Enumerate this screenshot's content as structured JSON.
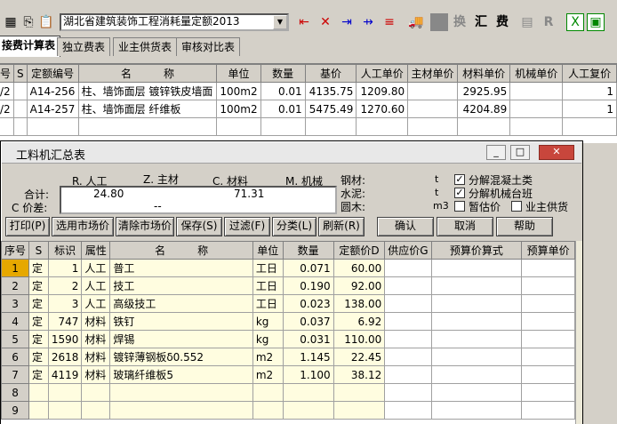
{
  "toolbar": {
    "quota_select": "湖北省建筑装饰工程消耗量定额2013",
    "glyph_huan": "换",
    "glyph_hui": "汇",
    "glyph_fei": "费",
    "glyph_r": "R"
  },
  "tabs": [
    "接费计算表",
    "独立费表",
    "业主供货表",
    "审核对比表"
  ],
  "main_grid": {
    "columns": [
      "号",
      "S",
      "定额编号",
      "名　　　称",
      "单位",
      "数量",
      "基价",
      "人工单价",
      "主材单价",
      "材料单价",
      "机械单价",
      "人工复价"
    ],
    "rows": [
      {
        "no": "/2",
        "code": "A14-256",
        "name": "柱、墙饰面层 镀锌铁皮墙面",
        "unit": "100m2",
        "qty": "0.01",
        "base": "4135.75",
        "labor": "1209.80",
        "main_mat": "",
        "mat": "2925.95",
        "mach": "",
        "labor_total": "1"
      },
      {
        "no": "/2",
        "code": "A14-257",
        "name": "柱、墙饰面层 纤维板",
        "unit": "100m2",
        "qty": "0.01",
        "base": "5475.49",
        "labor": "1270.60",
        "main_mat": "",
        "mat": "4204.89",
        "mach": "",
        "labor_total": "1"
      }
    ]
  },
  "dialog": {
    "title": "工料机汇总表",
    "summary_headers": [
      "R. 人工",
      "Z. 主材",
      "C. 材料",
      "M. 机械"
    ],
    "total_label": "合计:",
    "diff_label": "C 价差:",
    "total_labor": "24.80",
    "total_material": "71.31",
    "diff_value": "--",
    "materials": [
      {
        "label": "钢材:",
        "unit": "t"
      },
      {
        "label": "水泥:",
        "unit": "t"
      },
      {
        "label": "圆木:",
        "unit": "m3"
      }
    ],
    "options": [
      {
        "label": "分解混凝土类",
        "checked": true
      },
      {
        "label": "分解机械台班",
        "checked": true
      },
      {
        "label": "暂估价",
        "checked": false
      },
      {
        "label": "业主供货",
        "checked": false
      }
    ],
    "buttons": [
      "打印(P)",
      "选用市场价",
      "清除市场价",
      "保存(S)",
      "过滤(F)",
      "分类(L)",
      "刷新(R)",
      "确认",
      "取消",
      "帮助"
    ],
    "grid_columns": [
      "序号",
      "S",
      "标识",
      "属性",
      "名　　　称",
      "单位",
      "数量",
      "定额价D",
      "供应价G",
      "预算价算式",
      "预算单价"
    ],
    "grid_rows": [
      {
        "no": "1",
        "s": "定",
        "id": "1",
        "attr": "人工",
        "name": "普工",
        "unit": "工日",
        "qty": "0.071",
        "price": "60.00"
      },
      {
        "no": "2",
        "s": "定",
        "id": "2",
        "attr": "人工",
        "name": "技工",
        "unit": "工日",
        "qty": "0.190",
        "price": "92.00"
      },
      {
        "no": "3",
        "s": "定",
        "id": "3",
        "attr": "人工",
        "name": "高级技工",
        "unit": "工日",
        "qty": "0.023",
        "price": "138.00"
      },
      {
        "no": "4",
        "s": "定",
        "id": "747",
        "attr": "材料",
        "name": "铁钉",
        "unit": "kg",
        "qty": "0.037",
        "price": "6.92"
      },
      {
        "no": "5",
        "s": "定",
        "id": "1590",
        "attr": "材料",
        "name": "焊锡",
        "unit": "kg",
        "qty": "0.031",
        "price": "110.00"
      },
      {
        "no": "6",
        "s": "定",
        "id": "2618",
        "attr": "材料",
        "name": "镀锌薄钢板δ0.552",
        "unit": "m2",
        "qty": "1.145",
        "price": "22.45"
      },
      {
        "no": "7",
        "s": "定",
        "id": "4119",
        "attr": "材料",
        "name": "玻璃纤维板5",
        "unit": "m2",
        "qty": "1.100",
        "price": "38.12"
      },
      {
        "no": "8",
        "s": "",
        "id": "",
        "attr": "",
        "name": "",
        "unit": "",
        "qty": "",
        "price": ""
      },
      {
        "no": "9",
        "s": "",
        "id": "",
        "attr": "",
        "name": "",
        "unit": "",
        "qty": "",
        "price": ""
      }
    ]
  }
}
